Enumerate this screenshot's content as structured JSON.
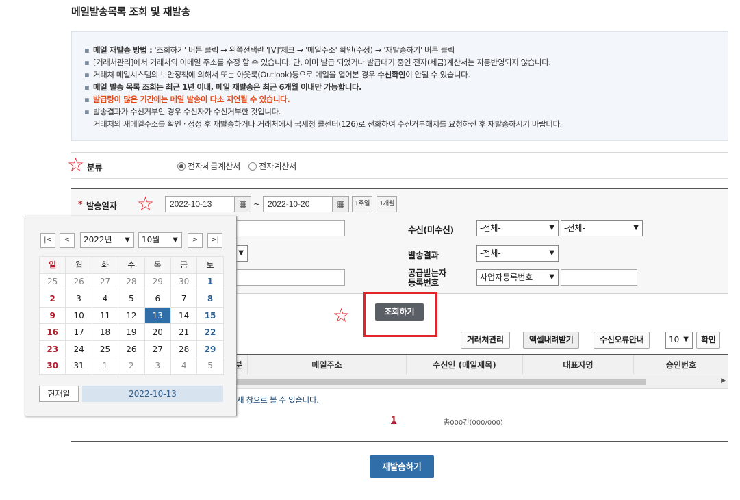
{
  "page_title": "메일발송목록 조회 및 재발송",
  "info": {
    "line1_label": "메일 재발송 방법 :",
    "line1_text": " '조회하기' 버튼 클릭 → 왼쪽선택란 '[V]'체크 → '메일주소' 확인(수정) → '재발송하기' 버튼 클릭",
    "line2": "[거래처관리]에서 거래처의 이메일 주소를 수정 할 수 있습니다. 단, 이미 발급 되었거나 발급대기 중인 전자(세금)계산서는 자동반영되지 않습니다.",
    "line3_pre": "거래처 메일시스템의 보안정책에 의해서 또는 아웃룩(Outlook)등으로 메일을 열어본 경우 ",
    "line3_bold": "수신확인",
    "line3_post": "이 안될 수 있습니다.",
    "line4": "메일 발송 목록 조회는 최근 1년 이내, 메일 재발송은 최근 6개월 이내만 가능합니다.",
    "line5": "발급량이 많은 기간에는 메일 발송이 다소 지연될 수 있습니다.",
    "line6": "발송결과가 수신거부인 경우 수신자가 수신거부한 것입니다.",
    "line7": "거래처의 새메일주소를 확인 · 정정 후 재발송하거나 거래처에서 국세청 콜센터(126)로 전화하여 수신거부해지를 요청하신 후 재발송하시기 바랍니다.",
    "bullet": "▪"
  },
  "category": {
    "label": "분류",
    "options": [
      "전자세금계산서",
      "전자계산서"
    ],
    "selected": "전자세금계산서"
  },
  "search": {
    "date_label": "발송일자",
    "required_mark": "*",
    "date_from": "2022-10-13",
    "date_to": "2022-10-20",
    "tilde": "~",
    "btn_1week": "1주일",
    "btn_1month": "1개월",
    "receive_label": "수신(미수신)",
    "receive_sel1": "-전체-",
    "receive_sel2": "-전체-",
    "result_label": "발송결과",
    "result_sel": "-전체-",
    "supplier_label_1": "공급받는자",
    "supplier_label_2": "등록번호",
    "supplier_sel": "사업자등록번호",
    "search_btn": "조회하기"
  },
  "toolbar": {
    "client_mgmt": "거래처관리",
    "excel": "엑셀내려받기",
    "error_guide": "수신오류안내",
    "page_size": "10",
    "confirm": "확인"
  },
  "table": {
    "headers": [
      "분",
      "메일주소",
      "수신인 (메일제목)",
      "대표자명",
      "승인번호"
    ]
  },
  "note": "새 창으로 볼 수 있습니다.",
  "pagination": {
    "current": "1",
    "total": "총000건(000/000)"
  },
  "resend_btn": "재발송하기",
  "calendar": {
    "year": "2022년",
    "month": "10월",
    "weekdays": [
      "일",
      "월",
      "화",
      "수",
      "목",
      "금",
      "토"
    ],
    "weeks": [
      [
        "25",
        "26",
        "27",
        "28",
        "29",
        "30",
        "1"
      ],
      [
        "2",
        "3",
        "4",
        "5",
        "6",
        "7",
        "8"
      ],
      [
        "9",
        "10",
        "11",
        "12",
        "13",
        "14",
        "15"
      ],
      [
        "16",
        "17",
        "18",
        "19",
        "20",
        "21",
        "22"
      ],
      [
        "23",
        "24",
        "25",
        "26",
        "27",
        "28",
        "29"
      ],
      [
        "30",
        "31",
        "1",
        "2",
        "3",
        "4",
        "5"
      ]
    ],
    "today_btn": "현재일",
    "today_value": "2022-10-13",
    "nav_first": "|<",
    "nav_prev": "<",
    "nav_next": ">",
    "nav_last": ">|"
  },
  "icons": {
    "star": "☆",
    "calendar": "▦",
    "chevron": "▼"
  },
  "colors": {
    "accent_red": "#e3242b",
    "primary_blue": "#2f6ea8",
    "dark_button": "#5a5f66"
  }
}
